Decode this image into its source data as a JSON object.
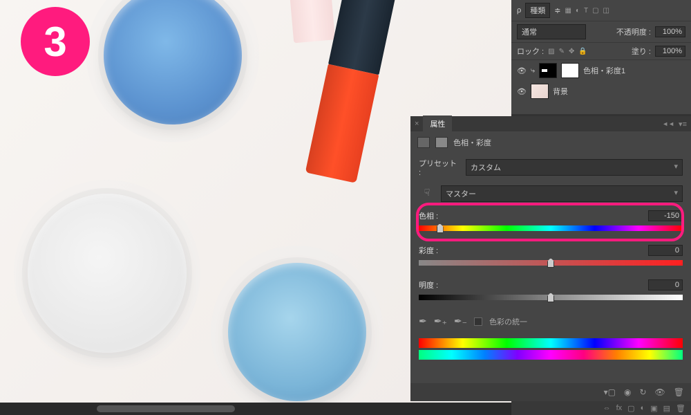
{
  "step_number": "3",
  "layers_panel": {
    "filter_label": "種類",
    "blend_mode": "通常",
    "opacity_label": "不透明度 :",
    "opacity_value": "100%",
    "lock_label": "ロック :",
    "fill_label": "塗り :",
    "fill_value": "100%",
    "layers": [
      {
        "name": "色相・彩度1",
        "selected": false,
        "is_adjustment": true
      },
      {
        "name": "背景",
        "selected": false,
        "is_adjustment": false
      }
    ]
  },
  "properties_panel": {
    "tab_title": "属性",
    "header_title": "色相・彩度",
    "preset_label": "プリセット :",
    "preset_value": "カスタム",
    "channel_value": "マスター",
    "sliders": {
      "hue": {
        "label": "色相 :",
        "value": "-150",
        "position_pct": 8
      },
      "saturation": {
        "label": "彩度 :",
        "value": "0",
        "position_pct": 50
      },
      "lightness": {
        "label": "明度 :",
        "value": "0",
        "position_pct": 50
      }
    },
    "colorize_label": "色彩の統一"
  }
}
